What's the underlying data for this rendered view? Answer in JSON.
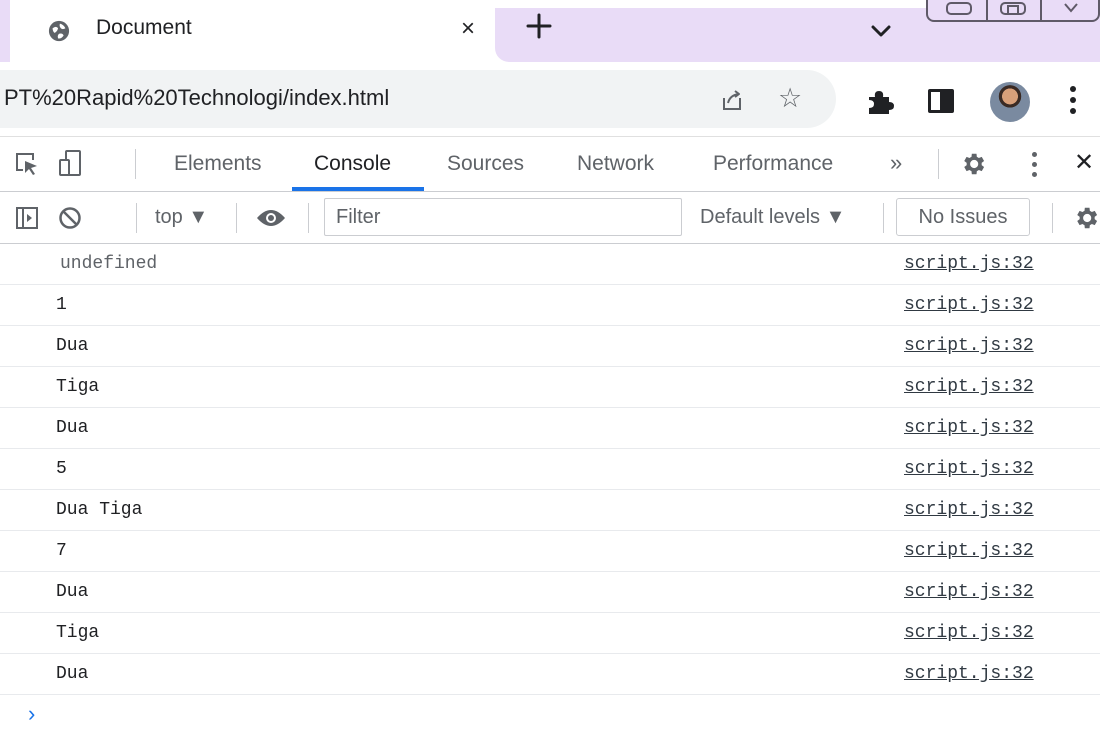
{
  "browser": {
    "tab_title": "Document",
    "tab_close_glyph": "×",
    "new_tab_glyph": "+",
    "url": "PT%20Rapid%20Technologi/index.html",
    "icons": [
      "globe-icon",
      "close-icon",
      "plus-icon",
      "chevron-down-icon",
      "share-icon",
      "star-icon",
      "puzzle-icon",
      "sidebar-icon",
      "avatar",
      "more-vertical-icon"
    ],
    "accent_color": "#e9dcf7"
  },
  "devtools": {
    "tabs": [
      {
        "label": "Elements",
        "active": false
      },
      {
        "label": "Console",
        "active": true
      },
      {
        "label": "Sources",
        "active": false
      },
      {
        "label": "Network",
        "active": false
      },
      {
        "label": "Performance",
        "active": false
      }
    ],
    "more_tabs_glyph": "»",
    "close_glyph": "✕",
    "active_tab_color": "#1a73e8"
  },
  "console_toolbar": {
    "context": "top ▼",
    "filter_placeholder": "Filter",
    "levels": "Default levels ▼",
    "issues": "No Issues"
  },
  "console_messages": [
    {
      "text": "undefined",
      "source": "script.js:32",
      "muted": true
    },
    {
      "text": "1",
      "source": "script.js:32"
    },
    {
      "text": "Dua",
      "source": "script.js:32"
    },
    {
      "text": "Tiga",
      "source": "script.js:32"
    },
    {
      "text": "Dua",
      "source": "script.js:32"
    },
    {
      "text": "5",
      "source": "script.js:32"
    },
    {
      "text": "Dua Tiga",
      "source": "script.js:32"
    },
    {
      "text": "7",
      "source": "script.js:32"
    },
    {
      "text": "Dua",
      "source": "script.js:32"
    },
    {
      "text": "Tiga",
      "source": "script.js:32"
    },
    {
      "text": "Dua",
      "source": "script.js:32"
    }
  ],
  "prompt_glyph": "›"
}
